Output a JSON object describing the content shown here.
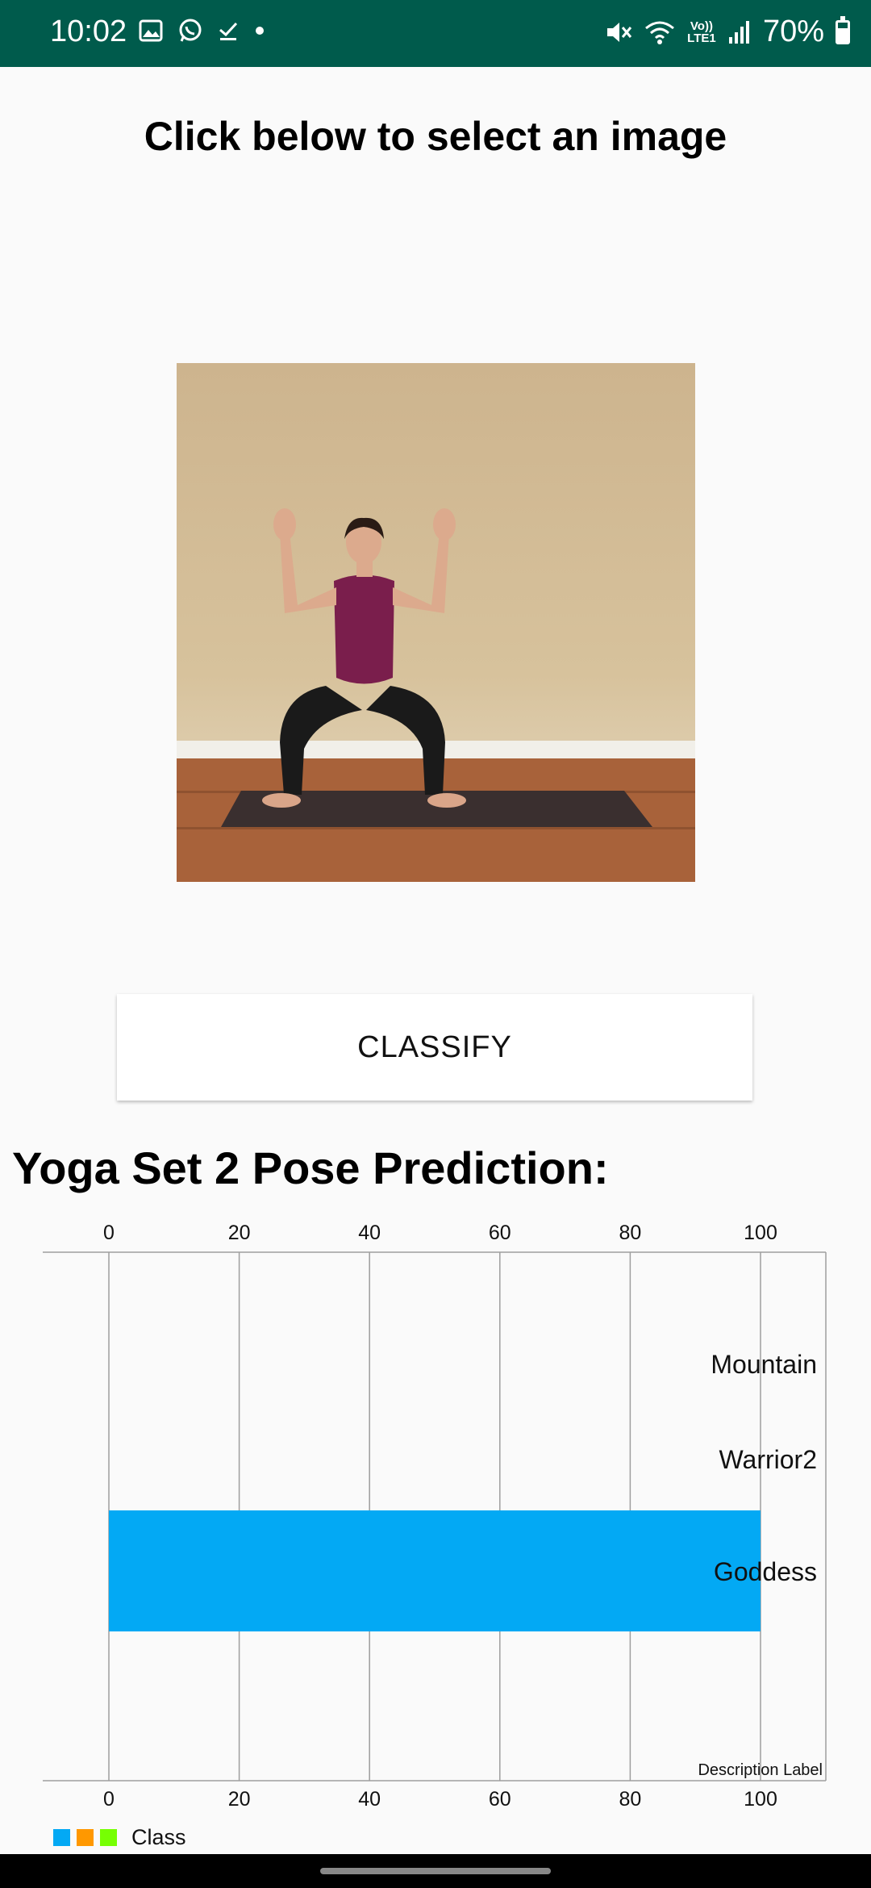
{
  "status_bar": {
    "time": "10:02",
    "battery_percent": "70%",
    "battery_level": 0.7,
    "network_label": "Vo)) LTE1",
    "icons_left": [
      "gallery-icon",
      "whatsapp-icon",
      "download-done-icon",
      "dot-icon"
    ],
    "icons_right": [
      "mute-icon",
      "wifi-icon",
      "lte-icon",
      "signal-icon",
      "battery-icon"
    ]
  },
  "header": {
    "title": "Click below to select an image"
  },
  "image": {
    "description": "yoga-goddess-pose-photo"
  },
  "actions": {
    "classify_label": "CLASSIFY"
  },
  "results": {
    "title": "Yoga Set 2 Pose Prediction:"
  },
  "chart_data": {
    "type": "bar",
    "orientation": "horizontal",
    "categories": [
      "Mountain",
      "Warrior2",
      "Goddess"
    ],
    "values": [
      0,
      0,
      100
    ],
    "xlim": [
      0,
      100
    ],
    "ticks": [
      0,
      20,
      40,
      60,
      80,
      100
    ],
    "description_label": "Description Label",
    "legend": {
      "label": "Class",
      "colors": [
        "#03a9f4",
        "#ff9800",
        "#76ff03"
      ]
    },
    "bar_color": "#03a9f4",
    "grid": true
  }
}
